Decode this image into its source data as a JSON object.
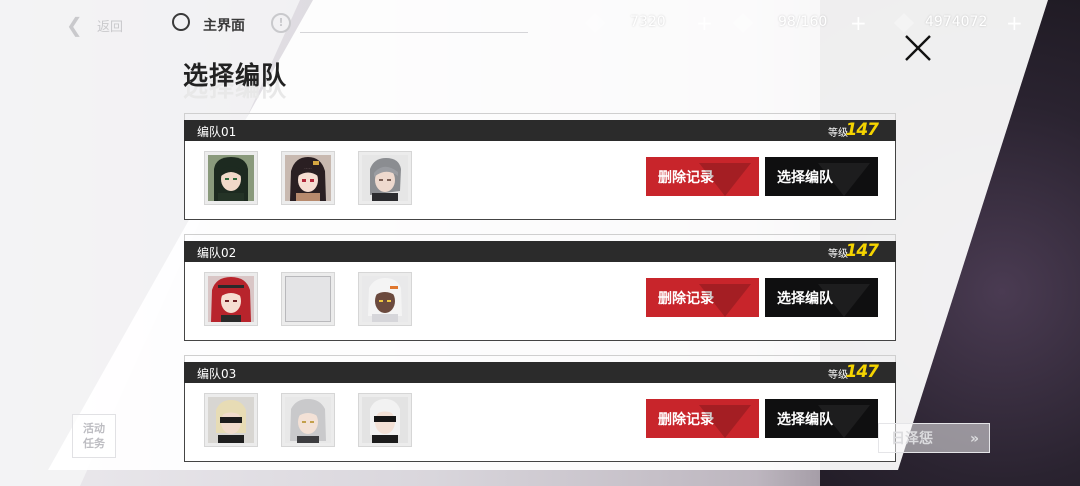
{
  "topbar": {
    "back_label": "返回",
    "home_label": "主界面",
    "resources": [
      {
        "value": "7320",
        "icon": "stamina-icon"
      },
      {
        "value": "98/160",
        "icon": "blackcard-icon"
      },
      {
        "value": "4974072",
        "icon": "coin-icon"
      }
    ],
    "plus": "+"
  },
  "dialog": {
    "title": "选择编队",
    "level_label": "等级",
    "delete_label": "删除记录",
    "select_label": "选择编队",
    "teams": [
      {
        "name": "编队01",
        "level": "147",
        "members": [
          "green-hair-character",
          "dark-hair-character",
          "silver-hair-character"
        ]
      },
      {
        "name": "编队02",
        "level": "147",
        "members": [
          "red-hair-character",
          "empty",
          "white-armored-character"
        ]
      },
      {
        "name": "编队03",
        "level": "147",
        "members": [
          "blindfold-blonde-character",
          "silver-hair-girl-character",
          "blindfold-white-character"
        ]
      }
    ]
  },
  "bottom": {
    "event_label_1": "活动",
    "event_label_2": "任务",
    "right_label": "日泽惩",
    "right_arrow": "»"
  }
}
